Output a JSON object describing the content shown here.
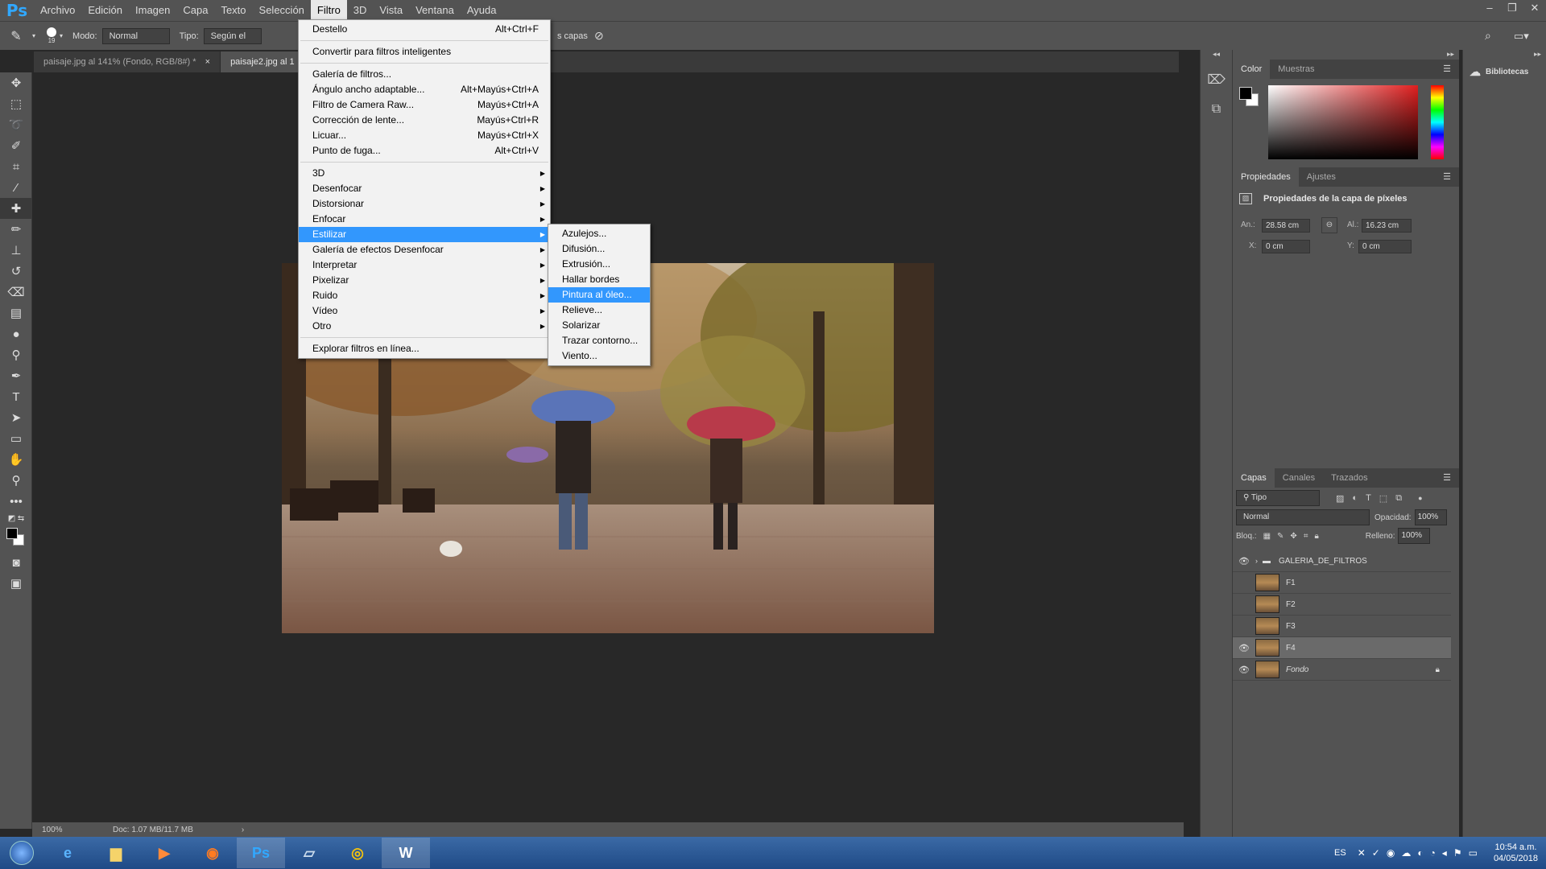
{
  "app": {
    "logo": "Ps"
  },
  "menubar": {
    "items": [
      "Archivo",
      "Edición",
      "Imagen",
      "Capa",
      "Texto",
      "Selección",
      "Filtro",
      "3D",
      "Vista",
      "Ventana",
      "Ayuda"
    ]
  },
  "options_bar": {
    "brush_size": "19",
    "mode_label": "Modo:",
    "mode_value": "Normal",
    "type_label": "Tipo:",
    "type_value": "Según el conten",
    "sample_all_layers": "s capas"
  },
  "tabs": [
    {
      "label": "paisaje.jpg al 141% (Fondo, RGB/8#) *",
      "close": "×"
    },
    {
      "label": "paisaje2.jpg al 1"
    }
  ],
  "status_bar": {
    "zoom": "100%",
    "doc": "Doc: 1.07 MB/11.7 MB",
    "arrow": "›"
  },
  "filter_menu": {
    "top": [
      {
        "label": "Destello",
        "shortcut": "Alt+Ctrl+F"
      },
      {
        "label": "Convertir para filtros inteligentes",
        "shortcut": ""
      }
    ],
    "group2": [
      {
        "label": "Galería de filtros...",
        "shortcut": ""
      },
      {
        "label": "Ángulo ancho adaptable...",
        "shortcut": "Alt+Mayús+Ctrl+A"
      },
      {
        "label": "Filtro de Camera Raw...",
        "shortcut": "Mayús+Ctrl+A"
      },
      {
        "label": "Corrección de lente...",
        "shortcut": "Mayús+Ctrl+R"
      },
      {
        "label": "Licuar...",
        "shortcut": "Mayús+Ctrl+X"
      },
      {
        "label": "Punto de fuga...",
        "shortcut": "Alt+Ctrl+V"
      }
    ],
    "submenus": [
      "3D",
      "Desenfocar",
      "Distorsionar",
      "Enfocar",
      "Estilizar",
      "Galería de efectos Desenfocar",
      "Interpretar",
      "Pixelizar",
      "Ruido",
      "Vídeo",
      "Otro"
    ],
    "browse": "Explorar filtros en línea..."
  },
  "stylize_submenu": [
    "Azulejos...",
    "Difusión...",
    "Extrusión...",
    "Hallar bordes",
    "Pintura al óleo...",
    "Relieve...",
    "Solarizar",
    "Trazar contorno...",
    "Viento..."
  ],
  "color_panel": {
    "tabs": [
      "Color",
      "Muestras"
    ]
  },
  "properties_panel": {
    "tabs": [
      "Propiedades",
      "Ajustes"
    ],
    "title": "Propiedades de la capa de píxeles",
    "width_label": "An.:",
    "width": "28.58 cm",
    "height_label": "Al.:",
    "height": "16.23 cm",
    "x_label": "X:",
    "x": "0 cm",
    "y_label": "Y:",
    "y": "0 cm"
  },
  "layers_panel": {
    "tabs": [
      "Capas",
      "Canales",
      "Trazados"
    ],
    "filter": "Tipo",
    "blend_mode": "Normal",
    "opacity_label": "Opacidad:",
    "opacity": "100%",
    "lock_label": "Bloq.:",
    "fill_label": "Relleno:",
    "fill": "100%",
    "layers": [
      {
        "name": "GALERIA_DE_FILTROS",
        "visible": true,
        "type": "group"
      },
      {
        "name": "F1",
        "visible": false
      },
      {
        "name": "F2",
        "visible": false
      },
      {
        "name": "F3",
        "visible": false
      },
      {
        "name": "F4",
        "visible": true,
        "selected": true
      },
      {
        "name": "Fondo",
        "visible": true,
        "locked": true
      }
    ]
  },
  "libraries": {
    "label": "Bibliotecas"
  },
  "taskbar": {
    "lang": "ES",
    "time": "10:54 a.m.",
    "date": "04/05/2018"
  }
}
